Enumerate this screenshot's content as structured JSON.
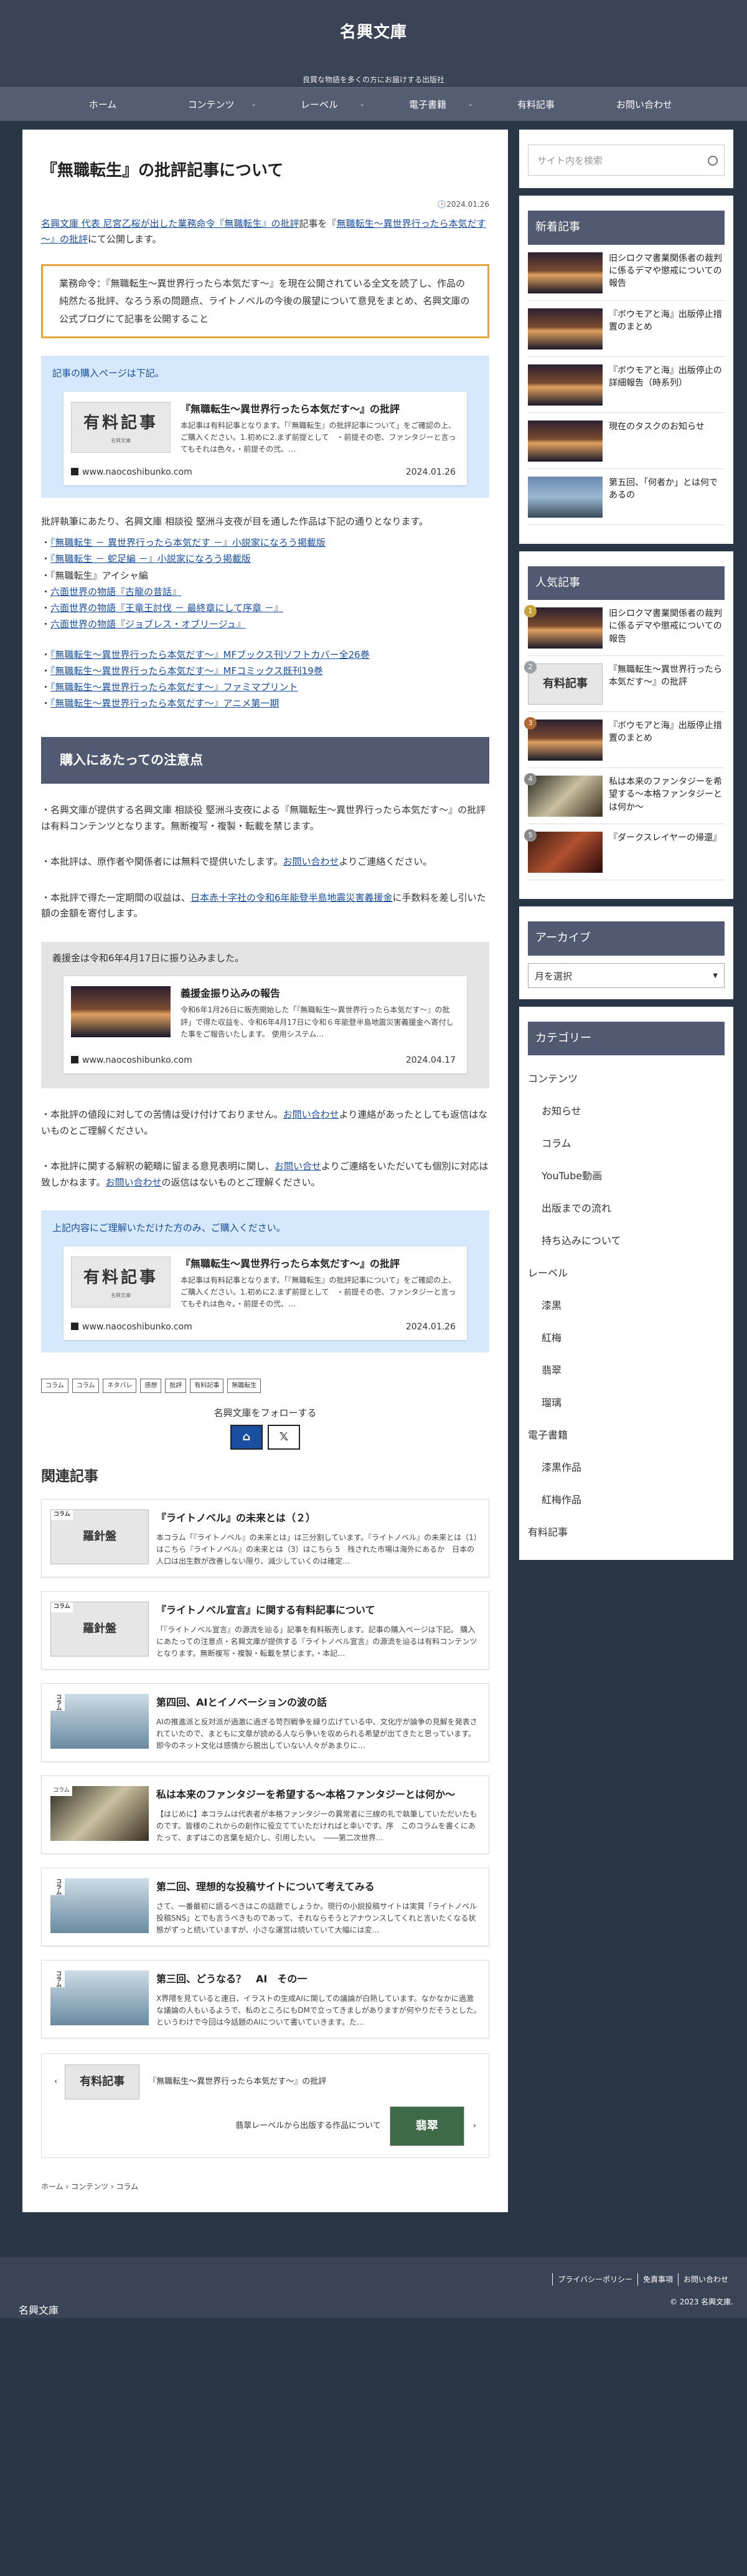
{
  "site": {
    "title": "名興文庫",
    "description": "良質な物語を多くの方にお届けする出版社"
  },
  "nav": [
    {
      "label": "ホーム",
      "chev": false
    },
    {
      "label": "コンテンツ",
      "chev": true
    },
    {
      "label": "レーベル",
      "chev": true
    },
    {
      "label": "電子書籍",
      "chev": true
    },
    {
      "label": "有料記事",
      "chev": false
    },
    {
      "label": "お問い合わせ",
      "chev": false
    }
  ],
  "article": {
    "title": "『無職転生』の批評記事について",
    "date": "2024.01.26",
    "intro_link1": "名興文庫 代表 尼宮乙桜が出した業務命令『無職転生』の批評",
    "intro_mid": "記事を『",
    "intro_link2": "無職転生～異世界行ったら本気だす～』の批評",
    "intro_end": "にて公開します。",
    "notice": "業務命令：『無職転生～異世界行ったら本気だす～』を現在公開されている全文を読了し、作品の純然たる批評、なろう系の問題点、ライトノベルの今後の展望について意見をまとめ、名興文庫の公式ブログにて記事を公開すること",
    "purchase_title": "記事の購入ページは下記。",
    "card": {
      "thumb_title": "有料記事",
      "thumb_sub": "名興文庫",
      "title": "『無職転生～異世界行ったら本気だす～』の批評",
      "excerpt": "本記事は有料記事となります。「『無職転生』の批評記事について」をご確認の上、ご購入ください。1.初めに2.まず前提として　・前提その壱、ファンタジーと言ってもそれは色々。・前提その弐、…",
      "domain": "www.naocoshibunko.com",
      "date": "2024.01.26"
    },
    "reading_intro": "批評執筆にあたり、名興文庫 相談役 堅洲斗支夜が目を通した作品は下記の通りとなります。",
    "works_a": [
      "『無職転生 － 異世界行ったら本気だす －』小説家になろう掲載版",
      "『無職転生 － 蛇足編 －』小説家になろう掲載版",
      "『無職転生』アイシャ編",
      "六面世界の物語『古龍の昔話』",
      "六面世界の物語『王竜王討伐 － 最終章にして序章 －』",
      "六面世界の物語『ジョブレス・オブリージュ』"
    ],
    "works_b": [
      "『無職転生～異世界行ったら本気だす～』MFブックス刊ソフトカバー全26巻",
      "『無職転生～異世界行ったら本気だす～』MFコミックス既刊19巻",
      "『無職転生～異世界行ったら本気だす～』ファミマプリント",
      "『無職転生～異世界行ったら本気だす～』アニメ第一期"
    ],
    "works_a_links": [
      true,
      true,
      false,
      true,
      true,
      true
    ],
    "bar": "購入にあたっての注意点",
    "p1": "・名興文庫が提供する名興文庫 相談役 堅洲斗支夜による『無職転生～異世界行ったら本気だす～』の批評は有料コンテンツとなります。無断複写・複製・転載を禁じます。",
    "p2_pre": "・本批評は、原作者や関係者には無料で提供いたします。",
    "p2_link": "お問い合わせ",
    "p2_post": "よりご連絡ください。",
    "p3_pre": "・本批評で得た一定期間の収益は、",
    "p3_link": "日本赤十字社の令和6年能登半島地震災害義援金",
    "p3_post": "に手数料を差し引いた額の金額を寄付します。",
    "grey_title": "義援金は令和6年4月17日に振り込みました。",
    "grey_card": {
      "title": "義援金振り込みの報告",
      "excerpt": "令和6年1月26日に販売開始した「『無職転生～異世界行ったら本気だす～』の批評」で得た収益を、令和6年4月17日に令和６年能登半島地震災害義援金へ寄付した事をご報告いたします。 使用システム…",
      "domain": "www.naocoshibunko.com",
      "date": "2024.04.17"
    },
    "p4_pre": "・本批評の値段に対しての苦情は受け付けておりません。",
    "p4_link": "お問い合わせ",
    "p4_post": "より連絡があったとしても返信はないものとご理解ください。",
    "p5_pre": "・本批評に関する解釈の範疇に留まる意見表明に関し、",
    "p5_link": "お問い合せ",
    "p5_mid": "よりご連絡をいただいても個別に対応は致しかねます。",
    "p5_link2": "お問い合わせ",
    "p5_post": "の返信はないものとご理解ください。",
    "purchase2_title": "上記内容にご理解いただけた方のみ、ご購入ください。",
    "tags": [
      "コラム",
      "コラム",
      "ネタバレ",
      "感想",
      "批評",
      "有料記事",
      "無職転生"
    ],
    "follow": "名興文庫をフォローする",
    "related_title": "関連記事",
    "related": [
      {
        "cat": "コラム",
        "thumb": "news",
        "title": "『ライトノベル』の未来とは（２）",
        "excerpt": "本コラム「『ライトノベル』の未来とは」は三分割しています。『ライトノベル』の未来とは（1）はこちら『ライトノベル』の未来とは（3）はこちら 5　残された市場は海外にあるか　日本の人口は出生数が改善しない限り、減少していくのは確定…"
      },
      {
        "cat": "コラム",
        "thumb": "news",
        "title": "『ライトノベル宣言』に関する有料記事について",
        "excerpt": "「『ライトノベル宣言』の源流を辿る」記事を有料販売します。記事の購入ページは下記。 購入にあたっての注意点・名興文庫が提供する『ライトノベル宣言』の源流を辿るは有料コンテンツとなります。無断複写・複製・転載を禁じます。・本記…"
      },
      {
        "cat": "コラム",
        "thumb": "ship",
        "title": "第四回、AIとイノベーションの波の話",
        "excerpt": "AIの推進派と反対派が過激に過ぎる苛烈戦争を繰り広げている中、文化庁が論争の見解を発表されていたので、まともに文章が読める人なら争いを収められる希望が出てきたと思っています。即今のネット文化は感情から脱出していない人々があまりに…"
      },
      {
        "cat": "コラム",
        "thumb": "drink",
        "title": "私は本来のファンタジーを希望する～本格ファンタジーとは何か～",
        "excerpt": "【はじめに】本コラムは代表者が本格ファンタジーの異常者に三線の礼で執筆していただいたものです。皆様のこれからの創作に役立てていただければと幸いです。序　このコラムを書くにあたって、まずはこの言葉を紹介し、引用したい。　――第二次世界…"
      },
      {
        "cat": "コラム",
        "thumb": "ship",
        "title": "第二回、理想的な投稿サイトについて考えてみる",
        "excerpt": "さて、一番最初に語るべきはこの話題でしょうか。現行の小説投稿サイトは実質「ライトノベル投稿SNS」とでも言うべきものであって、それならそうとアナウンスしてくれと言いたくなる状態がずっと続いていますが、小さな運営は続いていて大幅には変…"
      },
      {
        "cat": "コラム",
        "thumb": "ship",
        "title": "第三回、どうなる？　AI　その一",
        "excerpt": "X界隈を見ていると連日、イラストの生成AIに関しての議論が白熱しています。なかなかに過激な議論の人もいるようで、私のところにもDMで立ってきましがありますが何やりだそうとした。　というわけで今回は今話題のAIについて書いていきます。た…"
      }
    ],
    "pager_prev": "『無職転生～異世界行ったら本気だす～』の批評",
    "pager_next": "翡翠レーベルから出版する作品について",
    "pager_next_thumb": "翡翠",
    "breadcrumb": [
      "ホーム",
      "コンテンツ",
      "コラム"
    ]
  },
  "sidebar": {
    "search_placeholder": "サイト内を検索",
    "new_title": "新着記事",
    "new_items": [
      {
        "thumb": "sea",
        "text": "旧シロクマ書業関係者の裁判に係るデマや懲戒についての報告"
      },
      {
        "thumb": "sea",
        "text": "『ボウモアと海』出版停止措置のまとめ"
      },
      {
        "thumb": "sea",
        "text": "『ボウモアと海』出版停止の詳細報告（時系列）"
      },
      {
        "thumb": "sea",
        "text": "現在のタスクのお知らせ"
      },
      {
        "thumb": "boat",
        "text": "第五回、「何者か」とは何であるの"
      }
    ],
    "popular_title": "人気記事",
    "popular_items": [
      {
        "thumb": "sea",
        "rank": "1",
        "color": "#c8a23a",
        "text": "旧シロクマ書業関係者の裁判に係るデマや懲戒についての報告"
      },
      {
        "thumb": "news",
        "rank": "2",
        "color": "#9aa0a8",
        "text": "『無職転生～異世界行ったら本気だす～』の批評"
      },
      {
        "thumb": "sea",
        "rank": "3",
        "color": "#b06a30",
        "text": "『ボウモアと海』出版停止措置のまとめ"
      },
      {
        "thumb": "drink",
        "rank": "4",
        "color": "#888",
        "text": "私は本来のファンタジーを希望する～本格ファンタジーとは何か～"
      },
      {
        "thumb": "fire",
        "rank": "5",
        "color": "#888",
        "text": "『ダークスレイヤーの帰還』"
      }
    ],
    "archive_title": "アーカイブ",
    "archive_select": "月を選択",
    "category_title": "カテゴリー",
    "categories": [
      {
        "label": "コンテンツ",
        "child": false
      },
      {
        "label": "お知らせ",
        "child": true
      },
      {
        "label": "コラム",
        "child": true
      },
      {
        "label": "YouTube動画",
        "child": true
      },
      {
        "label": "出版までの流れ",
        "child": true
      },
      {
        "label": "持ち込みについて",
        "child": true
      },
      {
        "label": "レーベル",
        "child": false
      },
      {
        "label": "漆黒",
        "child": true
      },
      {
        "label": "紅梅",
        "child": true
      },
      {
        "label": "翡翠",
        "child": true
      },
      {
        "label": "瑠璃",
        "child": true
      },
      {
        "label": "電子書籍",
        "child": false
      },
      {
        "label": "漆黒作品",
        "child": true
      },
      {
        "label": "紅梅作品",
        "child": true
      },
      {
        "label": "有料記事",
        "child": false
      }
    ]
  },
  "footer": {
    "links": [
      "プライバシーポリシー",
      "免責事項",
      "お問い合わせ"
    ],
    "copyright": "© 2023 名興文庫.",
    "name": "名興文庫"
  }
}
